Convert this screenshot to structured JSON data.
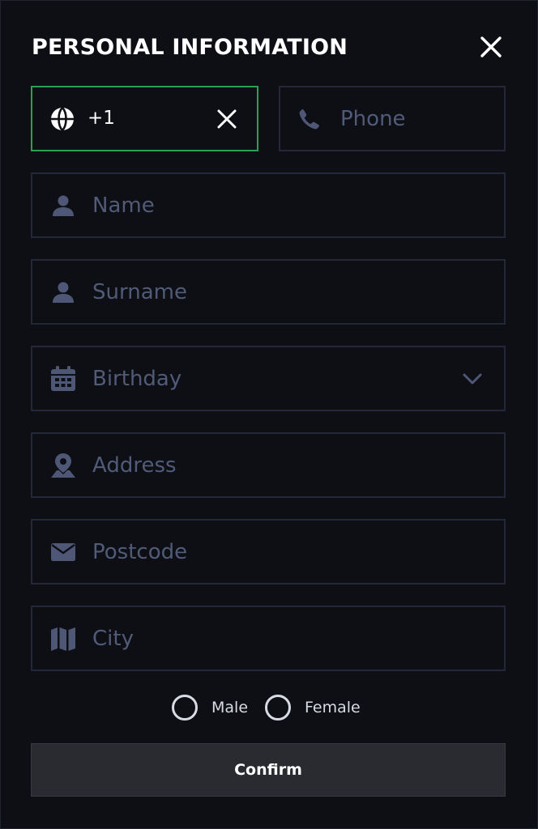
{
  "title": "PERSONAL INFORMATION",
  "phone_code": {
    "value": "+1"
  },
  "phone": {
    "placeholder": "Phone"
  },
  "fields": {
    "name": {
      "placeholder": "Name"
    },
    "surname": {
      "placeholder": "Surname"
    },
    "birthday": {
      "placeholder": "Birthday"
    },
    "address": {
      "placeholder": "Address"
    },
    "postcode": {
      "placeholder": "Postcode"
    },
    "city": {
      "placeholder": "City"
    }
  },
  "gender": {
    "male_label": "Male",
    "female_label": "Female"
  },
  "confirm_label": "Confirm",
  "colors": {
    "background": "#0d0f15",
    "field_border": "#22283a",
    "active_border": "#2aa052",
    "placeholder": "#515b78",
    "icon": "#4e5876",
    "button": "#2a2b31"
  },
  "icons": {
    "close": "close-icon",
    "globe": "globe-icon",
    "clear": "close-icon",
    "phone": "phone-icon",
    "name": "user-icon",
    "surname": "user-icon",
    "birthday": "calendar-icon",
    "birthday_dropdown": "chevron-down-icon",
    "address": "map-pin-icon",
    "postcode": "envelope-icon",
    "city": "map-icon"
  }
}
